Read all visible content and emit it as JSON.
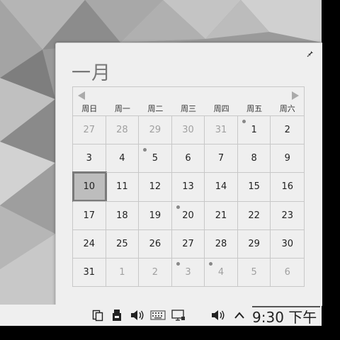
{
  "calendar": {
    "month_title": "一月",
    "weekdays": [
      "周日",
      "周一",
      "周二",
      "周三",
      "周四",
      "周五",
      "周六"
    ],
    "days": [
      {
        "d": "27",
        "m": true
      },
      {
        "d": "28",
        "m": true
      },
      {
        "d": "29",
        "m": true
      },
      {
        "d": "30",
        "m": true
      },
      {
        "d": "31",
        "m": true
      },
      {
        "d": "1",
        "dot": true
      },
      {
        "d": "2"
      },
      {
        "d": "3"
      },
      {
        "d": "4"
      },
      {
        "d": "5",
        "dot": true
      },
      {
        "d": "6"
      },
      {
        "d": "7"
      },
      {
        "d": "8"
      },
      {
        "d": "9"
      },
      {
        "d": "10",
        "today": true
      },
      {
        "d": "11"
      },
      {
        "d": "12"
      },
      {
        "d": "13"
      },
      {
        "d": "14"
      },
      {
        "d": "15"
      },
      {
        "d": "16"
      },
      {
        "d": "17"
      },
      {
        "d": "18"
      },
      {
        "d": "19"
      },
      {
        "d": "20",
        "dot": true
      },
      {
        "d": "21"
      },
      {
        "d": "22"
      },
      {
        "d": "23"
      },
      {
        "d": "24"
      },
      {
        "d": "25"
      },
      {
        "d": "26"
      },
      {
        "d": "27"
      },
      {
        "d": "28"
      },
      {
        "d": "29"
      },
      {
        "d": "30"
      },
      {
        "d": "31"
      },
      {
        "d": "1",
        "m": true
      },
      {
        "d": "2",
        "m": true
      },
      {
        "d": "3",
        "m": true,
        "dot": true
      },
      {
        "d": "4",
        "m": true,
        "dot": true
      },
      {
        "d": "5",
        "m": true
      },
      {
        "d": "6",
        "m": true
      }
    ]
  },
  "taskbar": {
    "clock": "9:30 下午",
    "tray_icons": [
      "clipboard-icon",
      "usb-drive-icon",
      "volume-icon",
      "keyboard-icon",
      "display-icon",
      "volume-icon",
      "chevron-up-icon"
    ]
  },
  "colors": {
    "popup_bg": "#efefef",
    "today_bg": "#bdbdbd",
    "event_dot": "#888888"
  }
}
